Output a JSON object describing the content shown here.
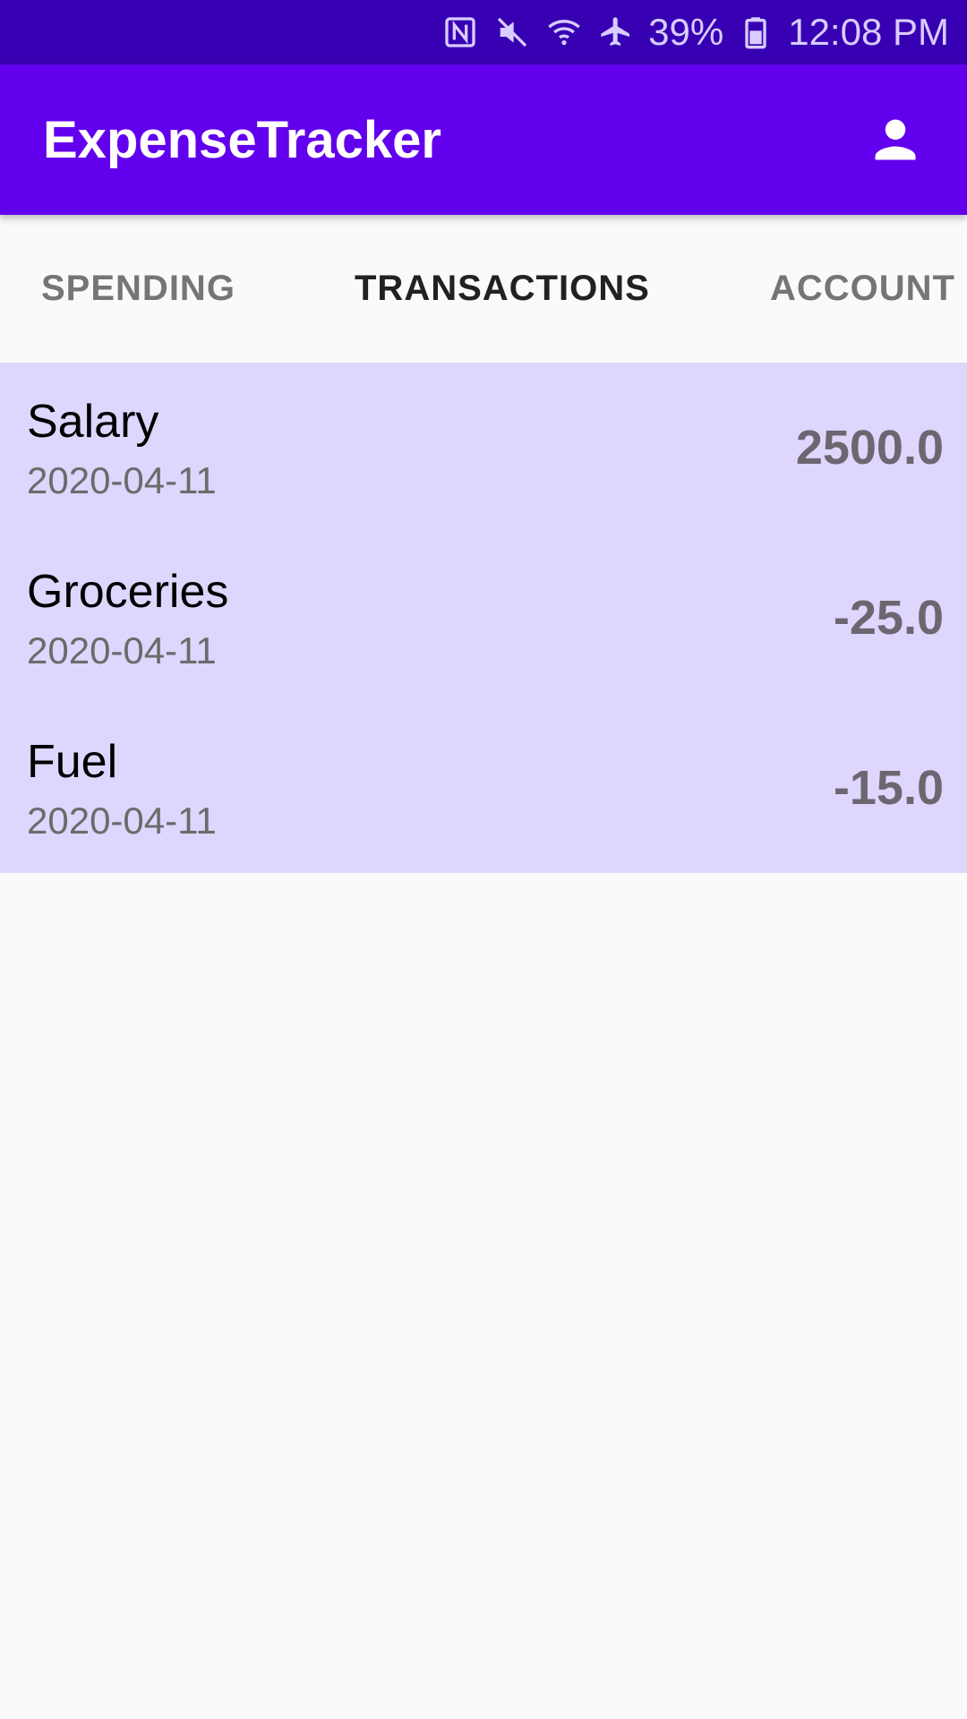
{
  "status_bar": {
    "icons": [
      "nfc-icon",
      "mute-icon",
      "wifi-icon",
      "airplane-icon",
      "battery-icon"
    ],
    "battery": "39%",
    "time": "12:08 PM"
  },
  "app_bar": {
    "title": "ExpenseTracker",
    "account_icon": "person-icon"
  },
  "tabs": [
    {
      "label": "SPENDING",
      "active": false
    },
    {
      "label": "TRANSACTIONS",
      "active": true
    },
    {
      "label": "ACCOUNT",
      "active": false
    }
  ],
  "transactions": [
    {
      "name": "Salary",
      "date": "2020-04-11",
      "amount": "2500.0"
    },
    {
      "name": "Groceries",
      "date": "2020-04-11",
      "amount": "-25.0"
    },
    {
      "name": "Fuel",
      "date": "2020-04-11",
      "amount": "-15.0"
    }
  ],
  "colors": {
    "status_bar": "#3700b3",
    "app_bar": "#6200ee",
    "list_background": "#ded6fd",
    "page_background": "#fafafa"
  }
}
